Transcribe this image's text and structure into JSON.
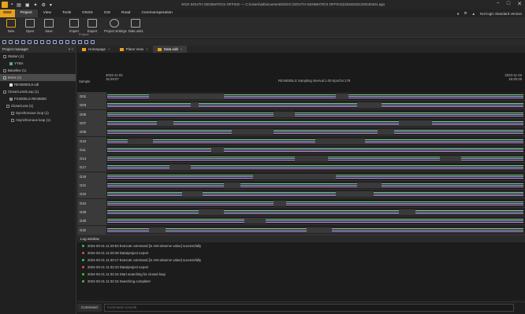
{
  "titlebar": {
    "title": "SGO SOUTH GEOMATICS OFFICE — C:\\Users\\a\\Documents\\SGO (SOUTH GEOMATICS OFFICE)\\20240321\\20240321.sgo",
    "icons": [
      "app-logo",
      "new-icon",
      "open-icon",
      "save-icon",
      "export-icon",
      "settings-icon",
      "star-icon"
    ],
    "window_controls": [
      "−",
      "□",
      "✕"
    ]
  },
  "menubar": {
    "items": [
      "SGO",
      "Project",
      "View",
      "Tools",
      "GNSS",
      "GNSS",
      "GIS",
      "Road",
      "Commonoperation"
    ],
    "right": {
      "user": "Not login Standard version"
    }
  },
  "ribbon": {
    "buttons": [
      {
        "label": "New"
      },
      {
        "label": "Open"
      },
      {
        "label": "Save"
      },
      {
        "label": "Import"
      },
      {
        "label": "Export"
      },
      {
        "label": "Project settings"
      },
      {
        "label": "Data units"
      }
    ],
    "group_label": "Project"
  },
  "left_panel": {
    "title": "Project manager",
    "items": [
      {
        "label": "Station (1)"
      },
      {
        "label": "YYBA"
      },
      {
        "label": "Baseline (1)"
      },
      {
        "label": "Items (1)"
      },
      {
        "label": "REX8000LS.sdl"
      },
      {
        "label": "Close/Loss/Loop (1)"
      },
      {
        "label": "FX2000LS REX8000"
      },
      {
        "label": "Close/Loss (1)"
      },
      {
        "label": "Synchronous loop (1)"
      },
      {
        "label": "Asynchronous loop (1)"
      }
    ]
  },
  "tabs": [
    {
      "label": "Homepage"
    },
    {
      "label": "Plane View"
    },
    {
      "label": "Data edit"
    }
  ],
  "timeline": {
    "station_label": "Sample",
    "start": "2023-11-02",
    "start_time": "15:29:07",
    "end": "2023-11-02",
    "end_time": "16:30:29",
    "center_text": "REX8000LS Sampling interval:1.00 Epochs:178"
  },
  "satellites": [
    "G01",
    "G03",
    "G06",
    "G07",
    "G08",
    "G10",
    "G11",
    "G14",
    "G17",
    "G19",
    "G21",
    "G22",
    "G24",
    "G28",
    "G30",
    "G32"
  ],
  "log": {
    "title": "Log window",
    "entries": [
      {
        "time": "2024-03-21 11:29:53",
        "text": "Execute command [in Anti-observe value] successfully",
        "status": "green"
      },
      {
        "time": "2024-03-21 11:29:48",
        "text": "Data/project export",
        "status": "red"
      },
      {
        "time": "2024-03-21 11:30:17",
        "text": "Execute command [in Anti-observe value] successfully",
        "status": "green"
      },
      {
        "time": "2024-03-21 11:32:10",
        "text": "Data/project export",
        "status": "red"
      },
      {
        "time": "2024-03-21 11:32:15",
        "text": "Start searching for closed loop",
        "status": "green"
      },
      {
        "time": "2024-03-21 11:32:15",
        "text": "Searching complete!",
        "status": "green"
      }
    ]
  },
  "command": {
    "label": "Command",
    "placeholder": "Command console"
  }
}
